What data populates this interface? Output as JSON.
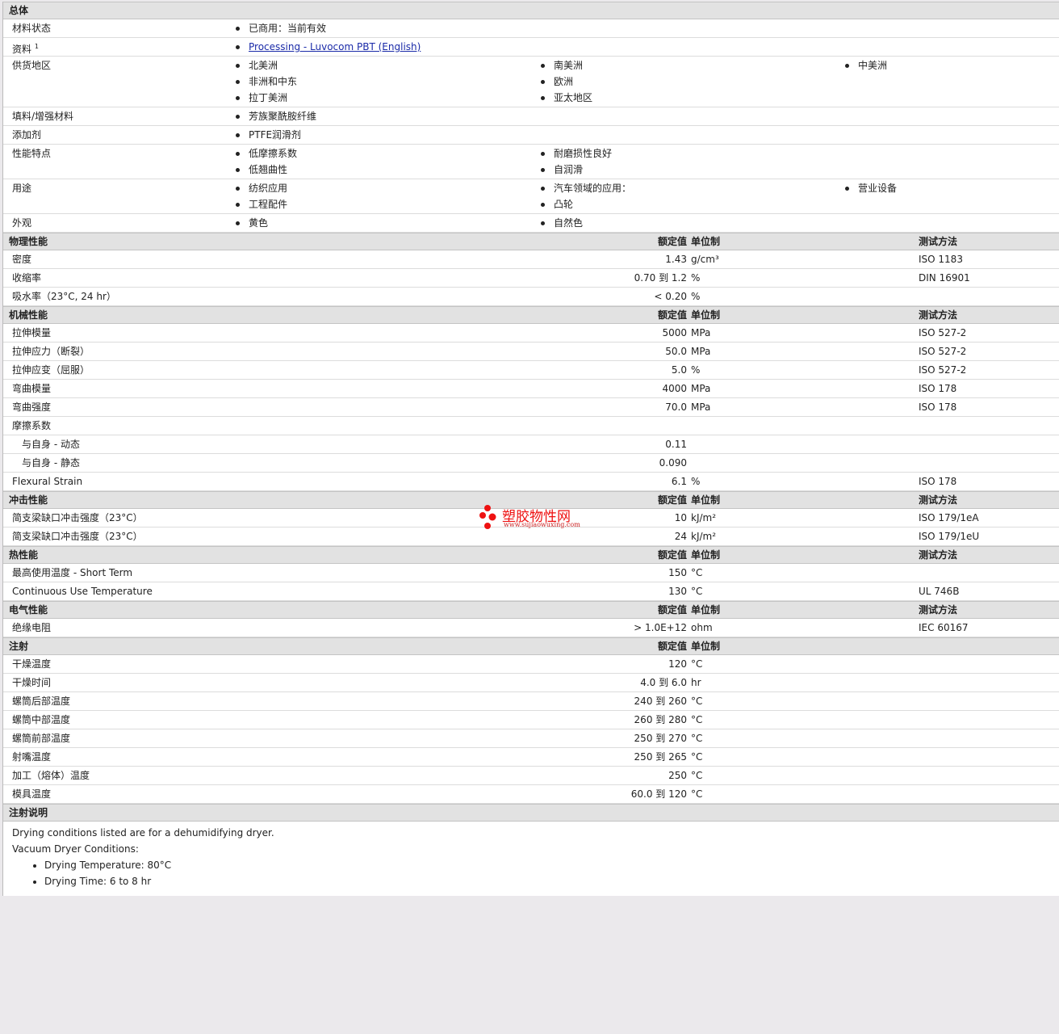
{
  "general": {
    "title": "总体",
    "status": {
      "label": "材料状态",
      "value": "已商用：当前有效"
    },
    "docs": {
      "label": "资料",
      "sup": "1",
      "link": "Processing - Luvocom PBT (English)"
    },
    "regions": {
      "label": "供货地区",
      "items": [
        "北美洲",
        "南美洲",
        "中美洲",
        "非洲和中东",
        "欧洲",
        "拉丁美洲",
        "亚太地区"
      ]
    },
    "filler": {
      "label": "填料/增强材料",
      "items": [
        "芳族聚酰胺纤维"
      ]
    },
    "additive": {
      "label": "添加剂",
      "items": [
        "PTFE润滑剂"
      ]
    },
    "features": {
      "label": "性能特点",
      "items": [
        "低摩擦系数",
        "耐磨损性良好",
        "低翘曲性",
        "自润滑"
      ]
    },
    "uses": {
      "label": "用途",
      "items": [
        "纺织应用",
        "汽车领域的应用：",
        "营业设备",
        "工程配件",
        "凸轮"
      ]
    },
    "appearance": {
      "label": "外观",
      "items": [
        "黄色",
        "自然色"
      ]
    }
  },
  "headers": {
    "value": "额定值",
    "unit": "单位制",
    "test": "测试方法"
  },
  "physical": {
    "title": "物理性能",
    "rows": [
      {
        "label": "密度",
        "value": "1.43",
        "unit": "g/cm³",
        "test": "ISO 1183"
      },
      {
        "label": "收缩率",
        "value": "0.70 到  1.2",
        "unit": "%",
        "test": "DIN 16901"
      },
      {
        "label": "吸水率（23°C, 24 hr）",
        "value": "< 0.20",
        "unit": "%",
        "test": ""
      }
    ]
  },
  "mechanical": {
    "title": "机械性能",
    "rows": [
      {
        "label": "拉伸模量",
        "value": "5000",
        "unit": "MPa",
        "test": "ISO 527-2"
      },
      {
        "label": "拉伸应力（断裂）",
        "value": "50.0",
        "unit": "MPa",
        "test": "ISO 527-2"
      },
      {
        "label": "拉伸应变（屈服）",
        "value": "5.0",
        "unit": "%",
        "test": "ISO 527-2"
      },
      {
        "label": "弯曲模量",
        "value": "4000",
        "unit": "MPa",
        "test": "ISO 178"
      },
      {
        "label": "弯曲强度",
        "value": "70.0",
        "unit": "MPa",
        "test": "ISO 178"
      },
      {
        "label": "摩擦系数",
        "value": "",
        "unit": "",
        "test": ""
      },
      {
        "label": "与自身  - 动态",
        "value": "0.11",
        "unit": "",
        "test": "",
        "indent": true
      },
      {
        "label": "与自身  - 静态",
        "value": "0.090",
        "unit": "",
        "test": "",
        "indent": true
      },
      {
        "label": "Flexural Strain",
        "value": "6.1",
        "unit": "%",
        "test": "ISO 178"
      }
    ]
  },
  "impact": {
    "title": "冲击性能",
    "rows": [
      {
        "label": "简支梁缺口冲击强度（23°C）",
        "value": "10",
        "unit": "kJ/m²",
        "test": "ISO 179/1eA"
      },
      {
        "label": "简支梁缺口冲击强度（23°C）",
        "value": "24",
        "unit": "kJ/m²",
        "test": "ISO 179/1eU"
      }
    ]
  },
  "thermal": {
    "title": "热性能",
    "rows": [
      {
        "label": "最高使用温度  - Short Term",
        "value": "150",
        "unit": "°C",
        "test": ""
      },
      {
        "label": "Continuous Use Temperature",
        "value": "130",
        "unit": "°C",
        "test": "UL 746B"
      }
    ]
  },
  "electrical": {
    "title": "电气性能",
    "rows": [
      {
        "label": "绝缘电阻",
        "value": "> 1.0E+12",
        "unit": "ohm",
        "test": "IEC 60167"
      }
    ]
  },
  "injection": {
    "title": "注射",
    "rows": [
      {
        "label": "干燥温度",
        "value": "120",
        "unit": "°C",
        "test": ""
      },
      {
        "label": "干燥时间",
        "value": "4.0 到  6.0",
        "unit": "hr",
        "test": ""
      },
      {
        "label": "螺筒后部温度",
        "value": "240 到  260",
        "unit": "°C",
        "test": ""
      },
      {
        "label": "螺筒中部温度",
        "value": "260 到  280",
        "unit": "°C",
        "test": ""
      },
      {
        "label": "螺筒前部温度",
        "value": "250 到  270",
        "unit": "°C",
        "test": ""
      },
      {
        "label": "射嘴温度",
        "value": "250 到  265",
        "unit": "°C",
        "test": ""
      },
      {
        "label": "加工（熔体）温度",
        "value": "250",
        "unit": "°C",
        "test": ""
      },
      {
        "label": "模具温度",
        "value": "60.0 到  120",
        "unit": "°C",
        "test": ""
      }
    ]
  },
  "notes": {
    "title": "注射说明",
    "line1": "Drying conditions listed are for a dehumidifying dryer.",
    "line2": "Vacuum Dryer Conditions:",
    "bullets": [
      "Drying Temperature: 80°C",
      "Drying Time: 6 to 8 hr"
    ]
  },
  "watermark": {
    "name": "塑胶物性网",
    "url": "www.sujiaowuxing.com"
  }
}
